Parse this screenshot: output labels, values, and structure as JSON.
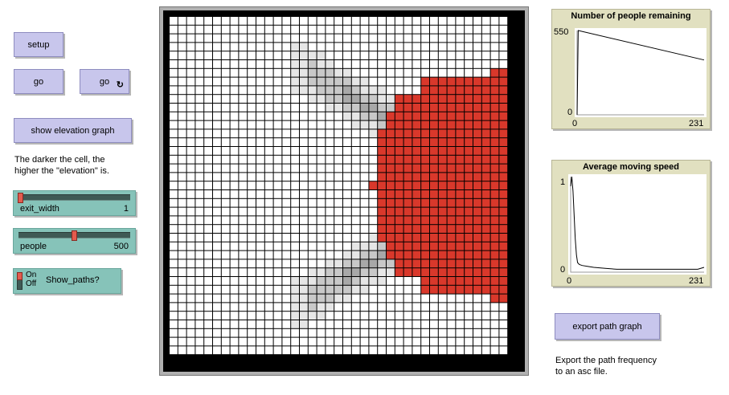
{
  "buttons": {
    "setup": "setup",
    "go": "go",
    "go_forever": "go",
    "show_elevation": "show elevation graph",
    "export": "export path graph"
  },
  "icons": {
    "forever": "forever-loop-icon"
  },
  "notes": {
    "elevation_line1": "The darker the cell, the",
    "elevation_line2": "higher the \"elevation\" is.",
    "export_line1": "Export the path frequency",
    "export_line2": "to an asc file."
  },
  "sliders": {
    "exit_width": {
      "label": "exit_width",
      "value": "1",
      "level": 0.0
    },
    "people": {
      "label": "people",
      "value": "500",
      "level": 0.5
    }
  },
  "switch": {
    "label": "Show_paths?",
    "on": "On",
    "off": "Off",
    "state": "On"
  },
  "plot_remaining": {
    "title": "Number of people  remaining",
    "y_max": "550",
    "y_min": "0",
    "x_min": "0",
    "x_max": "231",
    "chart_data": {
      "type": "line",
      "x": [
        0,
        2,
        231
      ],
      "y": [
        0,
        550,
        358
      ],
      "xlim": [
        0,
        231
      ],
      "ylim": [
        0,
        550
      ]
    }
  },
  "plot_speed": {
    "title": "Average moving speed",
    "y_max": "1",
    "y_min": "0",
    "x_min": "0",
    "x_max": "231",
    "chart_data": {
      "type": "line",
      "x": [
        0,
        2,
        4,
        6,
        8,
        10,
        12,
        15,
        20,
        30,
        40,
        60,
        80,
        100,
        120,
        140,
        160,
        180,
        200,
        220,
        231
      ],
      "y": [
        0.9,
        1.0,
        0.85,
        0.6,
        0.35,
        0.18,
        0.1,
        0.08,
        0.07,
        0.06,
        0.05,
        0.04,
        0.03,
        0.03,
        0.03,
        0.03,
        0.03,
        0.03,
        0.03,
        0.03,
        0.05
      ],
      "xlim": [
        0,
        231
      ],
      "ylim": [
        0,
        1
      ]
    }
  },
  "colors": {
    "button": "#c8c6ec",
    "widget": "#86c3b9",
    "plot_bg": "#e1e0c0",
    "patch_white": "#ffffff",
    "patch_light": "#e6e6e6",
    "patch_mid": "#c8c8c8",
    "patch_dark": "#a8a8a8",
    "person": "#d9382b",
    "grid": "#000000"
  }
}
